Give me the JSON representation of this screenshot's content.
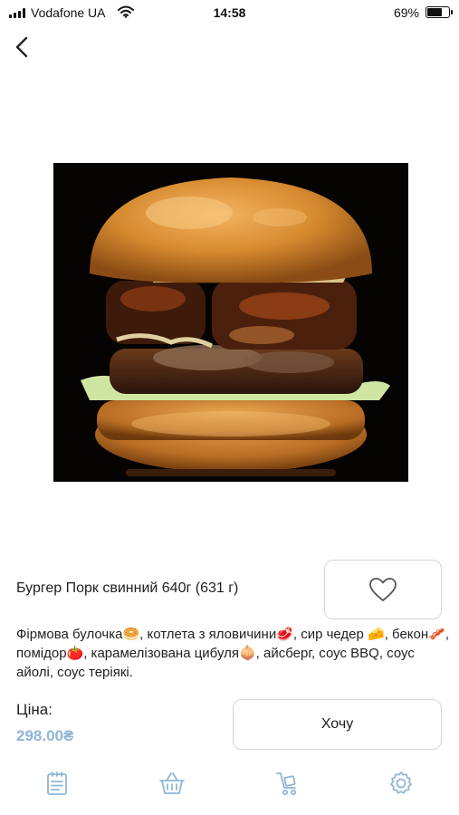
{
  "status_bar": {
    "carrier": "Vodafone UA",
    "time": "14:58",
    "battery": "69%"
  },
  "product": {
    "title": "Бургер Порк свинний 640г (631 г)",
    "description": "Фірмова булочка🥯, котлета з яловичини🥩, сир чедер 🧀, бекон🥓,   помідор🍅, карамелізована цибуля🧅, айсберг, соус BBQ, соус айолі, соус теріякі.",
    "price_label": "Ціна:",
    "price": "298.00₴",
    "order_button": "Хочу"
  },
  "icons": {
    "back": "chevron-left-icon",
    "favorite": "heart-icon",
    "tabs": [
      "menu-list-icon",
      "basket-icon",
      "delivery-cart-icon",
      "settings-gear-icon"
    ]
  },
  "colors": {
    "accent": "#8fb6d6",
    "tab_icon": "#8fb6d6",
    "border": "#d6d6d6"
  }
}
